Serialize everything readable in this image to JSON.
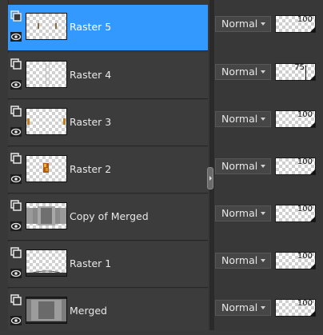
{
  "layers": [
    {
      "name": "Raster 5",
      "blend_mode": "Normal",
      "opacity": "100",
      "selected": true
    },
    {
      "name": "Raster 4",
      "blend_mode": "Normal",
      "opacity": "75",
      "selected": false
    },
    {
      "name": "Raster 3",
      "blend_mode": "Normal",
      "opacity": "100",
      "selected": false
    },
    {
      "name": "Raster 2",
      "blend_mode": "Normal",
      "opacity": "100",
      "selected": false
    },
    {
      "name": "Copy of Merged",
      "blend_mode": "Normal",
      "opacity": "100",
      "selected": false
    },
    {
      "name": "Raster 1",
      "blend_mode": "Normal",
      "opacity": "100",
      "selected": false
    },
    {
      "name": "Merged",
      "blend_mode": "Normal",
      "opacity": "100",
      "selected": false
    }
  ],
  "colors": {
    "selection": "#3399ff",
    "panel_bg": "#383838"
  },
  "icons": {
    "layer_type": "raster-layer-icon",
    "visibility": "eye-icon",
    "dropdown": "chevron-down-icon",
    "splitter": "splitter-collapse-icon"
  }
}
